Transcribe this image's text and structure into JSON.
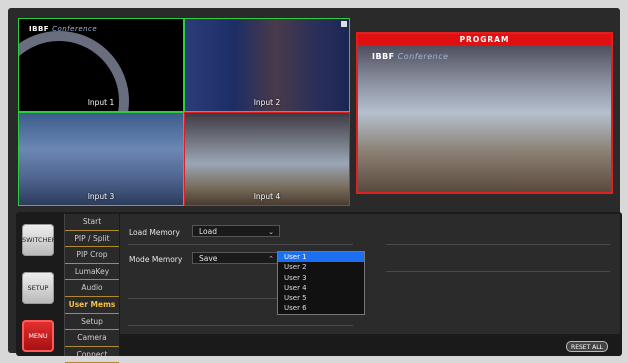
{
  "multiview": {
    "brand_name": "IBBF",
    "brand_sub": "Conference",
    "inputs": [
      {
        "label": "Input 1"
      },
      {
        "label": "Input 2"
      },
      {
        "label": "Input 3"
      },
      {
        "label": "Input 4"
      }
    ]
  },
  "program": {
    "title": "PROGRAM",
    "brand_name": "IBBF",
    "brand_sub": "Conference"
  },
  "side_buttons": {
    "switcher": "SWITCHER",
    "setup": "SETUP",
    "menu": "MENU"
  },
  "nav": {
    "items": [
      "Start",
      "PIP / Split",
      "PIP Crop",
      "LumaKey",
      "Audio",
      "User Mems",
      "Setup",
      "Camera",
      "Connect"
    ],
    "active": "User Mems"
  },
  "form": {
    "load_memory_label": "Load Memory",
    "load_memory_value": "Load",
    "mode_memory_label": "Mode Memory",
    "mode_memory_value": "Save"
  },
  "dropdown": {
    "options": [
      "User 1",
      "User 2",
      "User 3",
      "User 4",
      "User 5",
      "User 6"
    ],
    "selected": "User 1"
  },
  "reset_all_label": "RESET ALL",
  "colors": {
    "active_nav": "#f0c040",
    "program_red": "#e01010",
    "preview_green": "#2ecc40",
    "dropdown_selected": "#1d6ff2"
  }
}
